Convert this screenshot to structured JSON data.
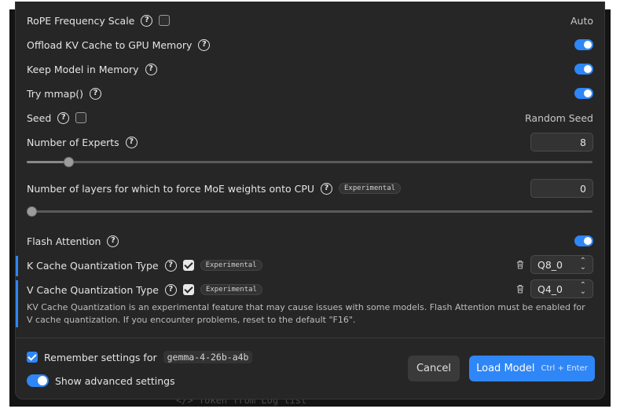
{
  "settings": {
    "rope": {
      "label": "RoPE Frequency Scale",
      "value": "Auto"
    },
    "offload": {
      "label": "Offload KV Cache to GPU Memory"
    },
    "keep_model": {
      "label": "Keep Model in Memory"
    },
    "mmap": {
      "label": "Try mmap()"
    },
    "seed": {
      "label": "Seed",
      "value": "Random Seed"
    },
    "experts": {
      "label": "Number of Experts",
      "value": "8",
      "slider_fraction": 0.065
    },
    "moe_cpu": {
      "label": "Number of layers for which to force MoE weights onto CPU",
      "badge": "Experimental",
      "value": "0",
      "slider_fraction": 0.0
    },
    "flash_attention": {
      "label": "Flash Attention"
    },
    "k_cache": {
      "label": "K Cache Quantization Type",
      "badge": "Experimental",
      "value": "Q8_0"
    },
    "v_cache": {
      "label": "V Cache Quantization Type",
      "badge": "Experimental",
      "value": "Q4_0"
    },
    "kv_note": "KV Cache Quantization is an experimental feature that may cause issues with some models. Flash Attention must be enabled for V cache quantization. If you encounter problems, reset to the default \"F16\"."
  },
  "footer": {
    "remember_label": "Remember settings for",
    "model_name": "gemma-4-26b-a4b",
    "advanced_label": "Show advanced settings",
    "cancel_label": "Cancel",
    "load_label": "Load Model",
    "load_shortcut": "Ctrl + Enter"
  },
  "background": {
    "text": "</> Token from Log list"
  },
  "colors": {
    "accent": "#2f86f6",
    "dialog_bg": "#262626"
  }
}
